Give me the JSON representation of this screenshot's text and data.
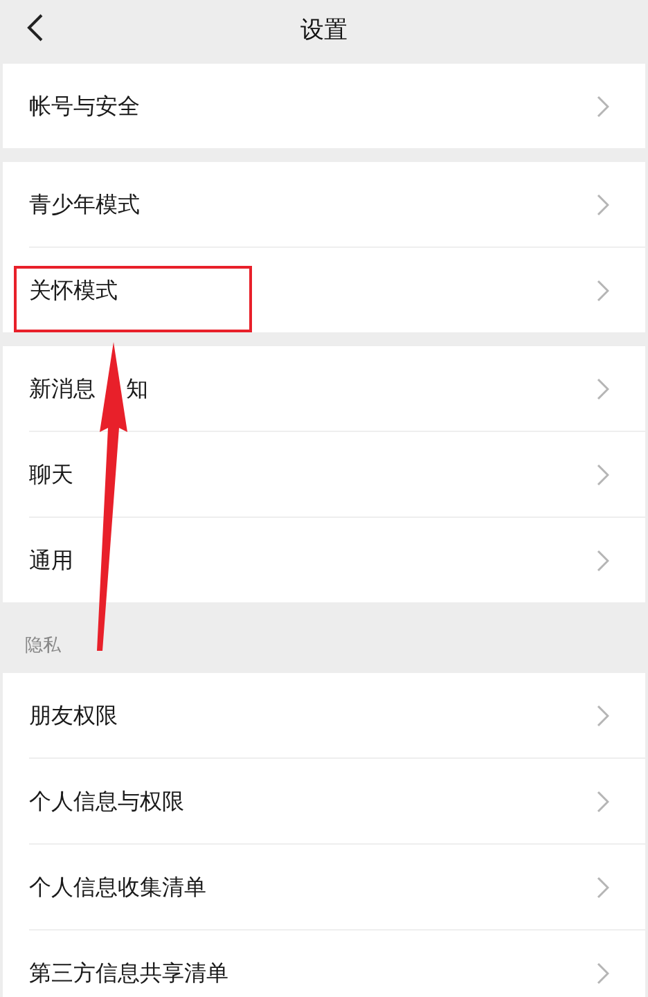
{
  "header": {
    "title": "设置"
  },
  "sections": [
    {
      "items": [
        {
          "label": "帐号与安全",
          "highlighted": false
        }
      ]
    },
    {
      "items": [
        {
          "label": "青少年模式",
          "highlighted": false
        },
        {
          "label": "关怀模式",
          "highlighted": true
        }
      ]
    },
    {
      "items": [
        {
          "label": "新消息",
          "label_after_cover": "知",
          "highlighted": false
        },
        {
          "label": "聊天",
          "highlighted": false
        },
        {
          "label": "通用",
          "highlighted": false
        }
      ]
    },
    {
      "label": "隐私",
      "items": [
        {
          "label": "朋友权限",
          "highlighted": false
        },
        {
          "label": "个人信息与权限",
          "highlighted": false
        },
        {
          "label": "个人信息收集清单",
          "highlighted": false
        },
        {
          "label": "第三方信息共享清单",
          "highlighted": false
        }
      ]
    }
  ]
}
